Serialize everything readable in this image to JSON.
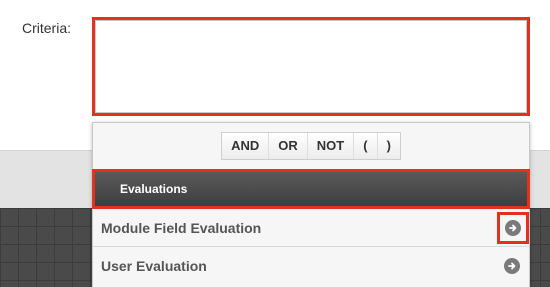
{
  "criteria": {
    "label": "Criteria:",
    "value": ""
  },
  "operators": [
    "AND",
    "OR",
    "NOT",
    "(",
    ")"
  ],
  "evaluations": {
    "header": "Evaluations",
    "items": [
      {
        "label": "Module Field Evaluation",
        "icon": "arrow-right-circle-icon"
      },
      {
        "label": "User Evaluation",
        "icon": "arrow-right-circle-icon"
      }
    ]
  },
  "colors": {
    "highlight": "#e2321e",
    "header_bg": "#4a4a4a",
    "icon_gray": "#7a7a7a"
  }
}
